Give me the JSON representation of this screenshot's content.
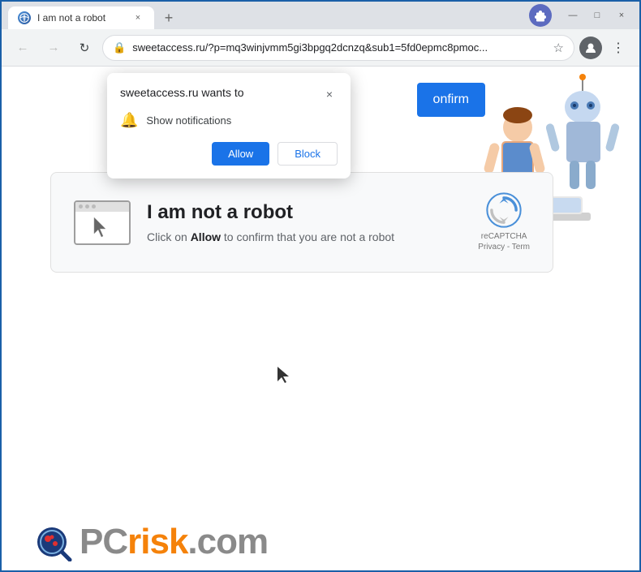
{
  "browser": {
    "tab_title": "I am not a robot",
    "tab_close_label": "×",
    "new_tab_label": "+",
    "address": "sweetaccess.ru/?p=mq3winjvmm5gi3bpgq2dcnzq&sub1=5fd0epmc8pmoc...",
    "window_controls": {
      "minimize": "—",
      "maximize": "□",
      "close": "×"
    }
  },
  "toolbar": {
    "back_label": "←",
    "forward_label": "→",
    "refresh_label": "↻",
    "star_label": "☆",
    "extensions_label": "⊕",
    "profile_label": "👤",
    "menu_label": "⋮"
  },
  "notification_popup": {
    "title": "sweetaccess.ru wants to",
    "close_label": "×",
    "notification_label": "Show notifications",
    "allow_label": "Allow",
    "block_label": "Block"
  },
  "confirm_btn": {
    "label": "onfirm"
  },
  "main_card": {
    "title": "I am not a robot",
    "subtitle_pre": "Click on ",
    "subtitle_bold": "Allow",
    "subtitle_post": " to confirm that you are not a robot",
    "recaptcha_line1": "reCAPTCHA",
    "recaptcha_line2": "Privacy - Term"
  },
  "bottom_logo": {
    "text_pc": "PC",
    "text_risk": "risk",
    "text_com": ".com"
  }
}
